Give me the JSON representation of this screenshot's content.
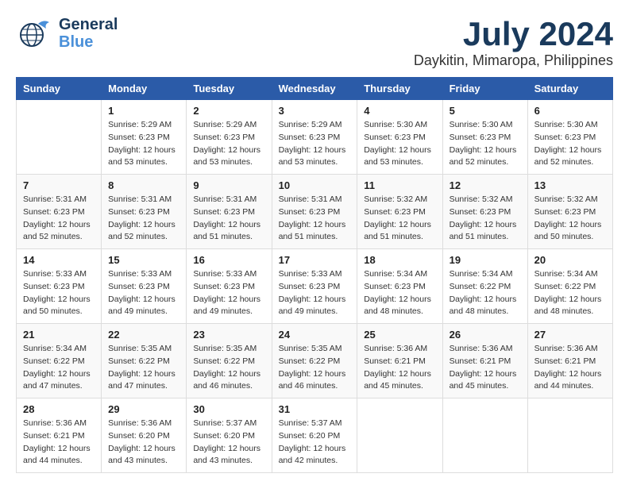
{
  "header": {
    "logo_line1": "General",
    "logo_line2": "Blue",
    "month_year": "July 2024",
    "location": "Daykitin, Mimaropa, Philippines"
  },
  "weekdays": [
    "Sunday",
    "Monday",
    "Tuesday",
    "Wednesday",
    "Thursday",
    "Friday",
    "Saturday"
  ],
  "weeks": [
    [
      {
        "day": "",
        "sunrise": "",
        "sunset": "",
        "daylight": ""
      },
      {
        "day": "1",
        "sunrise": "Sunrise: 5:29 AM",
        "sunset": "Sunset: 6:23 PM",
        "daylight": "Daylight: 12 hours and 53 minutes."
      },
      {
        "day": "2",
        "sunrise": "Sunrise: 5:29 AM",
        "sunset": "Sunset: 6:23 PM",
        "daylight": "Daylight: 12 hours and 53 minutes."
      },
      {
        "day": "3",
        "sunrise": "Sunrise: 5:29 AM",
        "sunset": "Sunset: 6:23 PM",
        "daylight": "Daylight: 12 hours and 53 minutes."
      },
      {
        "day": "4",
        "sunrise": "Sunrise: 5:30 AM",
        "sunset": "Sunset: 6:23 PM",
        "daylight": "Daylight: 12 hours and 53 minutes."
      },
      {
        "day": "5",
        "sunrise": "Sunrise: 5:30 AM",
        "sunset": "Sunset: 6:23 PM",
        "daylight": "Daylight: 12 hours and 52 minutes."
      },
      {
        "day": "6",
        "sunrise": "Sunrise: 5:30 AM",
        "sunset": "Sunset: 6:23 PM",
        "daylight": "Daylight: 12 hours and 52 minutes."
      }
    ],
    [
      {
        "day": "7",
        "sunrise": "Sunrise: 5:31 AM",
        "sunset": "Sunset: 6:23 PM",
        "daylight": "Daylight: 12 hours and 52 minutes."
      },
      {
        "day": "8",
        "sunrise": "Sunrise: 5:31 AM",
        "sunset": "Sunset: 6:23 PM",
        "daylight": "Daylight: 12 hours and 52 minutes."
      },
      {
        "day": "9",
        "sunrise": "Sunrise: 5:31 AM",
        "sunset": "Sunset: 6:23 PM",
        "daylight": "Daylight: 12 hours and 51 minutes."
      },
      {
        "day": "10",
        "sunrise": "Sunrise: 5:31 AM",
        "sunset": "Sunset: 6:23 PM",
        "daylight": "Daylight: 12 hours and 51 minutes."
      },
      {
        "day": "11",
        "sunrise": "Sunrise: 5:32 AM",
        "sunset": "Sunset: 6:23 PM",
        "daylight": "Daylight: 12 hours and 51 minutes."
      },
      {
        "day": "12",
        "sunrise": "Sunrise: 5:32 AM",
        "sunset": "Sunset: 6:23 PM",
        "daylight": "Daylight: 12 hours and 51 minutes."
      },
      {
        "day": "13",
        "sunrise": "Sunrise: 5:32 AM",
        "sunset": "Sunset: 6:23 PM",
        "daylight": "Daylight: 12 hours and 50 minutes."
      }
    ],
    [
      {
        "day": "14",
        "sunrise": "Sunrise: 5:33 AM",
        "sunset": "Sunset: 6:23 PM",
        "daylight": "Daylight: 12 hours and 50 minutes."
      },
      {
        "day": "15",
        "sunrise": "Sunrise: 5:33 AM",
        "sunset": "Sunset: 6:23 PM",
        "daylight": "Daylight: 12 hours and 49 minutes."
      },
      {
        "day": "16",
        "sunrise": "Sunrise: 5:33 AM",
        "sunset": "Sunset: 6:23 PM",
        "daylight": "Daylight: 12 hours and 49 minutes."
      },
      {
        "day": "17",
        "sunrise": "Sunrise: 5:33 AM",
        "sunset": "Sunset: 6:23 PM",
        "daylight": "Daylight: 12 hours and 49 minutes."
      },
      {
        "day": "18",
        "sunrise": "Sunrise: 5:34 AM",
        "sunset": "Sunset: 6:23 PM",
        "daylight": "Daylight: 12 hours and 48 minutes."
      },
      {
        "day": "19",
        "sunrise": "Sunrise: 5:34 AM",
        "sunset": "Sunset: 6:22 PM",
        "daylight": "Daylight: 12 hours and 48 minutes."
      },
      {
        "day": "20",
        "sunrise": "Sunrise: 5:34 AM",
        "sunset": "Sunset: 6:22 PM",
        "daylight": "Daylight: 12 hours and 48 minutes."
      }
    ],
    [
      {
        "day": "21",
        "sunrise": "Sunrise: 5:34 AM",
        "sunset": "Sunset: 6:22 PM",
        "daylight": "Daylight: 12 hours and 47 minutes."
      },
      {
        "day": "22",
        "sunrise": "Sunrise: 5:35 AM",
        "sunset": "Sunset: 6:22 PM",
        "daylight": "Daylight: 12 hours and 47 minutes."
      },
      {
        "day": "23",
        "sunrise": "Sunrise: 5:35 AM",
        "sunset": "Sunset: 6:22 PM",
        "daylight": "Daylight: 12 hours and 46 minutes."
      },
      {
        "day": "24",
        "sunrise": "Sunrise: 5:35 AM",
        "sunset": "Sunset: 6:22 PM",
        "daylight": "Daylight: 12 hours and 46 minutes."
      },
      {
        "day": "25",
        "sunrise": "Sunrise: 5:36 AM",
        "sunset": "Sunset: 6:21 PM",
        "daylight": "Daylight: 12 hours and 45 minutes."
      },
      {
        "day": "26",
        "sunrise": "Sunrise: 5:36 AM",
        "sunset": "Sunset: 6:21 PM",
        "daylight": "Daylight: 12 hours and 45 minutes."
      },
      {
        "day": "27",
        "sunrise": "Sunrise: 5:36 AM",
        "sunset": "Sunset: 6:21 PM",
        "daylight": "Daylight: 12 hours and 44 minutes."
      }
    ],
    [
      {
        "day": "28",
        "sunrise": "Sunrise: 5:36 AM",
        "sunset": "Sunset: 6:21 PM",
        "daylight": "Daylight: 12 hours and 44 minutes."
      },
      {
        "day": "29",
        "sunrise": "Sunrise: 5:36 AM",
        "sunset": "Sunset: 6:20 PM",
        "daylight": "Daylight: 12 hours and 43 minutes."
      },
      {
        "day": "30",
        "sunrise": "Sunrise: 5:37 AM",
        "sunset": "Sunset: 6:20 PM",
        "daylight": "Daylight: 12 hours and 43 minutes."
      },
      {
        "day": "31",
        "sunrise": "Sunrise: 5:37 AM",
        "sunset": "Sunset: 6:20 PM",
        "daylight": "Daylight: 12 hours and 42 minutes."
      },
      {
        "day": "",
        "sunrise": "",
        "sunset": "",
        "daylight": ""
      },
      {
        "day": "",
        "sunrise": "",
        "sunset": "",
        "daylight": ""
      },
      {
        "day": "",
        "sunrise": "",
        "sunset": "",
        "daylight": ""
      }
    ]
  ]
}
